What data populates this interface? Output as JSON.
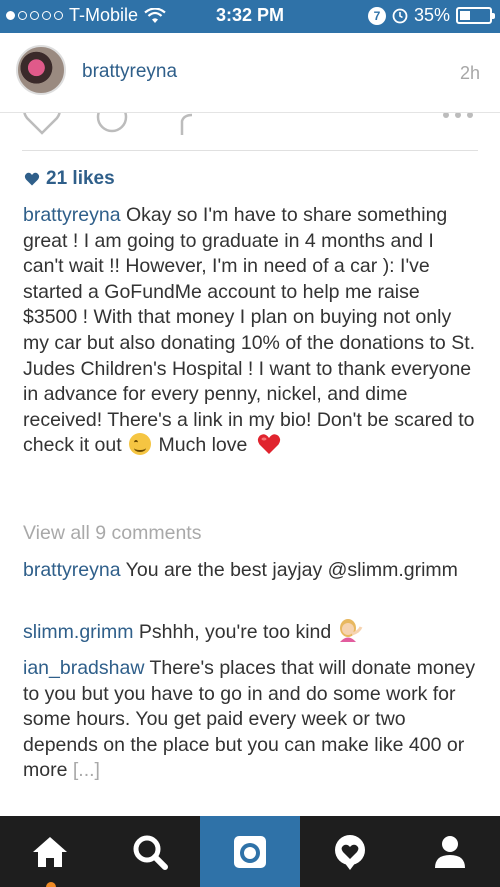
{
  "status_bar": {
    "carrier": "T-Mobile",
    "time": "3:32 PM",
    "battery": "35%",
    "battery_level": 0.35,
    "signal_bars_filled": 1,
    "signal_bars_total": 5
  },
  "post": {
    "username": "brattyreyna",
    "time_ago": "2h",
    "likes": "21 likes",
    "caption_user": "brattyreyna",
    "caption_text": "Okay so I'm have to share something great ! I am going to graduate in 4 months and I can't wait !! However, I'm in need of a car ): I've started a GoFundMe account to help me raise $3500 ! With that money I plan on buying not only my car but also donating 10% of the donations to St. Judes Children's Hospital ! I want to thank everyone in advance for every penny, nickel, and dime received! There's a link in my bio! Don't be scared to check it out",
    "caption_text_2": "Much love",
    "view_all": "View all 9 comments"
  },
  "comments": [
    {
      "user": "brattyreyna",
      "text": "You are the best jayjay @slimm.grimm"
    },
    {
      "user": "slimm.grimm",
      "text": "Pshhh,  you're too kind"
    },
    {
      "user": "ian_bradshaw",
      "text": "There's places that will donate money to you but you have to go in and do some work for some hours. You get paid every week or two depends on the place but you can make like 400 or more",
      "more": "[...]"
    }
  ],
  "tabs": [
    {
      "icon": "home-icon"
    },
    {
      "icon": "search-icon"
    },
    {
      "icon": "camera-icon",
      "active": true
    },
    {
      "icon": "activity-icon"
    },
    {
      "icon": "profile-icon"
    }
  ],
  "colors": {
    "accent_blue": "#2f72a8",
    "username_blue": "#2f5f8a",
    "tabbar_bg": "#1e1e1e",
    "muted_gray": "#a9a9a9"
  }
}
